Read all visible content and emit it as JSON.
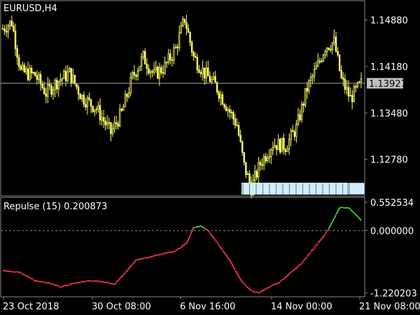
{
  "window": {
    "title": "EURUSD,H4"
  },
  "main_panel": {
    "price_ticks": [
      "1.14880",
      "1.14180",
      "1.13480",
      "1.12780"
    ],
    "current_price": "1.13927",
    "bar_count": 200,
    "price_range": [
      1.1225,
      1.1515
    ]
  },
  "indicator_panel": {
    "title": "Repulse (15) 0.200873",
    "ticks": [
      "0.552534",
      "0.000000",
      "-1.220203"
    ],
    "range": [
      -1.28,
      0.62
    ]
  },
  "time_axis": {
    "labels": [
      "23 Oct 2018",
      "30 Oct 08:00",
      "6 Nov 16:00",
      "14 Nov 00:00",
      "21 Nov 08:00"
    ]
  },
  "chart_data": [
    {
      "type": "candlestick",
      "title": "EURUSD,H4",
      "ylim": [
        1.1225,
        1.1515
      ],
      "ticks": [
        1.1488,
        1.1418,
        1.1348,
        1.1278
      ],
      "close_anchors": [
        {
          "i": 0,
          "v": 1.1475
        },
        {
          "i": 5,
          "v": 1.1485
        },
        {
          "i": 10,
          "v": 1.141
        },
        {
          "i": 18,
          "v": 1.1405
        },
        {
          "i": 24,
          "v": 1.1378
        },
        {
          "i": 30,
          "v": 1.1395
        },
        {
          "i": 37,
          "v": 1.1408
        },
        {
          "i": 44,
          "v": 1.1372
        },
        {
          "i": 52,
          "v": 1.1355
        },
        {
          "i": 60,
          "v": 1.1318
        },
        {
          "i": 66,
          "v": 1.1348
        },
        {
          "i": 72,
          "v": 1.1402
        },
        {
          "i": 78,
          "v": 1.1432
        },
        {
          "i": 84,
          "v": 1.1405
        },
        {
          "i": 90,
          "v": 1.1418
        },
        {
          "i": 96,
          "v": 1.1445
        },
        {
          "i": 101,
          "v": 1.149
        },
        {
          "i": 106,
          "v": 1.1432
        },
        {
          "i": 112,
          "v": 1.1408
        },
        {
          "i": 118,
          "v": 1.139
        },
        {
          "i": 124,
          "v": 1.136
        },
        {
          "i": 130,
          "v": 1.133
        },
        {
          "i": 134,
          "v": 1.1268
        },
        {
          "i": 138,
          "v": 1.1235
        },
        {
          "i": 143,
          "v": 1.1272
        },
        {
          "i": 150,
          "v": 1.1302
        },
        {
          "i": 157,
          "v": 1.1298
        },
        {
          "i": 163,
          "v": 1.1325
        },
        {
          "i": 169,
          "v": 1.1385
        },
        {
          "i": 175,
          "v": 1.142
        },
        {
          "i": 179,
          "v": 1.1448
        },
        {
          "i": 184,
          "v": 1.1455
        },
        {
          "i": 188,
          "v": 1.1398
        },
        {
          "i": 193,
          "v": 1.137
        },
        {
          "i": 199,
          "v": 1.1392
        }
      ]
    },
    {
      "type": "line",
      "title": "Repulse (15) 0.200873",
      "ylim": [
        -1.28,
        0.62
      ],
      "ticks": [
        0.552534,
        0.0,
        -1.220203
      ],
      "series": [
        {
          "points": [
            {
              "i": 0,
              "v": -0.78
            },
            {
              "i": 10,
              "v": -0.82
            },
            {
              "i": 18,
              "v": -0.98
            },
            {
              "i": 25,
              "v": -1.02
            },
            {
              "i": 32,
              "v": -1.1
            },
            {
              "i": 40,
              "v": -1.03
            },
            {
              "i": 48,
              "v": -0.98
            },
            {
              "i": 56,
              "v": -1.0
            },
            {
              "i": 62,
              "v": -1.05
            },
            {
              "i": 68,
              "v": -0.82
            },
            {
              "i": 74,
              "v": -0.58
            },
            {
              "i": 80,
              "v": -0.53
            },
            {
              "i": 88,
              "v": -0.46
            },
            {
              "i": 96,
              "v": -0.4
            },
            {
              "i": 102,
              "v": -0.25
            },
            {
              "i": 106,
              "v": 0.06
            },
            {
              "i": 110,
              "v": 0.08
            },
            {
              "i": 114,
              "v": 0.0
            },
            {
              "i": 120,
              "v": -0.28
            },
            {
              "i": 126,
              "v": -0.58
            },
            {
              "i": 132,
              "v": -0.96
            },
            {
              "i": 138,
              "v": -1.18
            },
            {
              "i": 142,
              "v": -1.22
            },
            {
              "i": 148,
              "v": -1.1
            },
            {
              "i": 154,
              "v": -1.0
            },
            {
              "i": 160,
              "v": -0.82
            },
            {
              "i": 166,
              "v": -0.64
            },
            {
              "i": 172,
              "v": -0.38
            },
            {
              "i": 178,
              "v": -0.12
            },
            {
              "i": 182,
              "v": 0.1
            },
            {
              "i": 187,
              "v": 0.45
            },
            {
              "i": 192,
              "v": 0.45
            },
            {
              "i": 199,
              "v": 0.2
            }
          ]
        }
      ]
    }
  ],
  "colors": {
    "background": "#000000",
    "candle": "#ffff66",
    "grid": "#888888",
    "axis_text": "#ffffff",
    "price_box_bg": "#c0c0c0",
    "price_box_text": "#000000",
    "indicator_down": "#e0304a",
    "indicator_up": "#40c040",
    "zero_line": "#888888",
    "time_label_bg": "#cfeefe"
  }
}
